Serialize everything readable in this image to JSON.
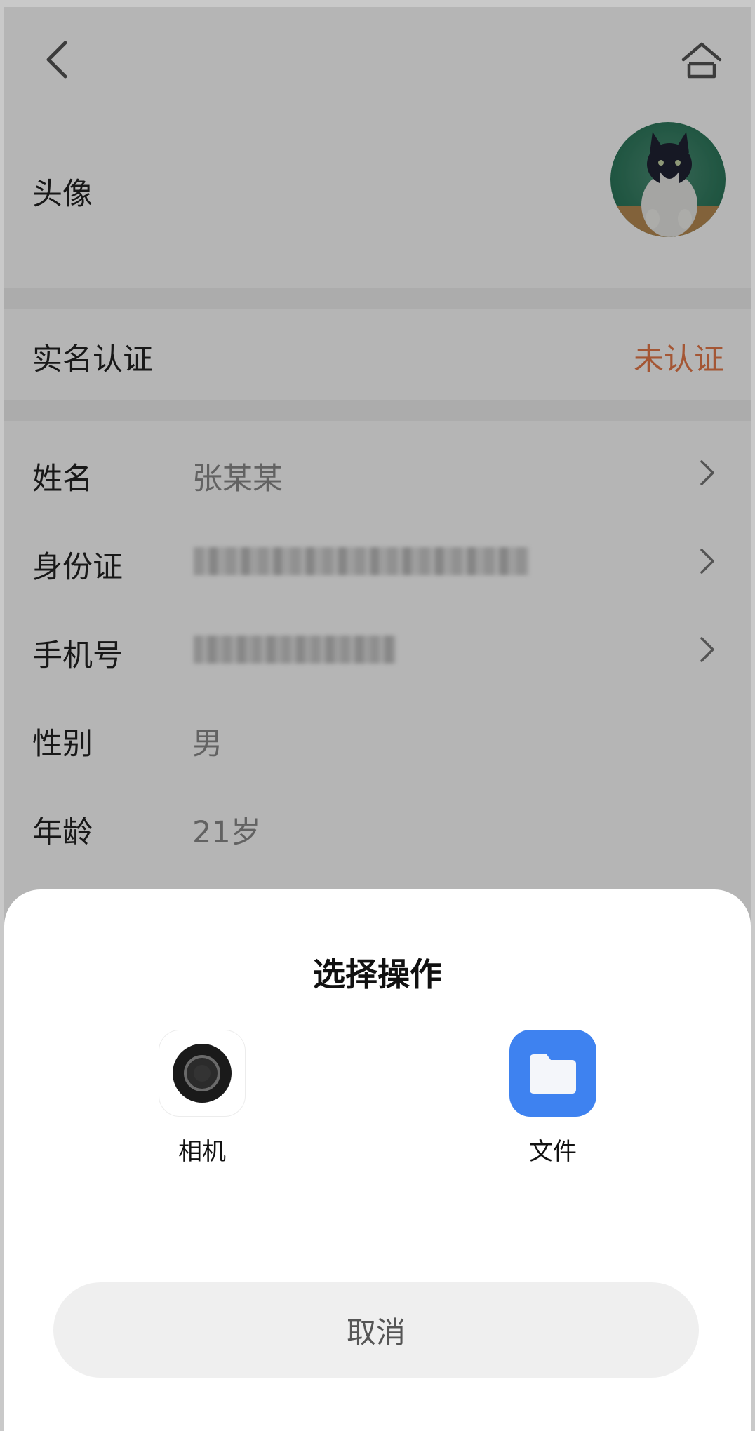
{
  "header": {
    "back_icon": "chevron-left-icon",
    "home_icon": "home-icon"
  },
  "profile": {
    "avatar_label": "头像",
    "verification_label": "实名认证",
    "verification_status": "未认证",
    "fields": [
      {
        "label": "姓名",
        "value": "张某某",
        "has_chevron": true
      },
      {
        "label": "身份证",
        "value": "",
        "has_chevron": true
      },
      {
        "label": "手机号",
        "value": "",
        "has_chevron": true
      },
      {
        "label": "性别",
        "value": "男",
        "has_chevron": false
      },
      {
        "label": "年龄",
        "value": "21岁",
        "has_chevron": false
      }
    ]
  },
  "sheet": {
    "title": "选择操作",
    "options": [
      {
        "label": "相机",
        "icon": "camera-icon"
      },
      {
        "label": "文件",
        "icon": "folder-icon"
      }
    ],
    "cancel_label": "取消"
  },
  "colors": {
    "accent_status": "#e8794a",
    "files_icon_bg": "#3e82f0",
    "overlay": "rgba(0,0,0,0.29)"
  }
}
